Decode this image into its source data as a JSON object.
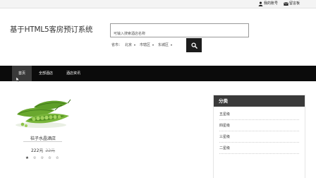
{
  "topbar": {
    "account_label": "我的账号",
    "feedback_label": "留言板",
    "account_icon": "user-icon",
    "feedback_icon": "envelope-icon"
  },
  "header": {
    "site_title": "基于HTML5客房预订系统",
    "search": {
      "placeholder": "可输入搜索酒店名称",
      "value": ""
    },
    "filters": {
      "province_label": "省市：",
      "city": "北京",
      "district_group": "市辖区",
      "district": "东城区"
    },
    "search_button_icon": "search-icon"
  },
  "nav": {
    "items": [
      {
        "label": "首页",
        "active": true
      },
      {
        "label": "全部酒店",
        "active": false
      },
      {
        "label": "酒店资讯",
        "active": false
      }
    ]
  },
  "hotel": {
    "name": "桔子水晶酒店",
    "price": "222元",
    "old_price": "22元",
    "rating": 1,
    "max_rating": 5,
    "stars_text": "★ ☆ ☆ ☆ ☆"
  },
  "categories": {
    "title": "分类",
    "items": [
      "五星级",
      "四星级",
      "三星级",
      "二星级"
    ]
  },
  "colors": {
    "nav_bg": "#0b0b0b",
    "nav_active": "#3a3a3a",
    "panel_header": "#3a3a3a",
    "search_button": "#1c1c1c"
  }
}
